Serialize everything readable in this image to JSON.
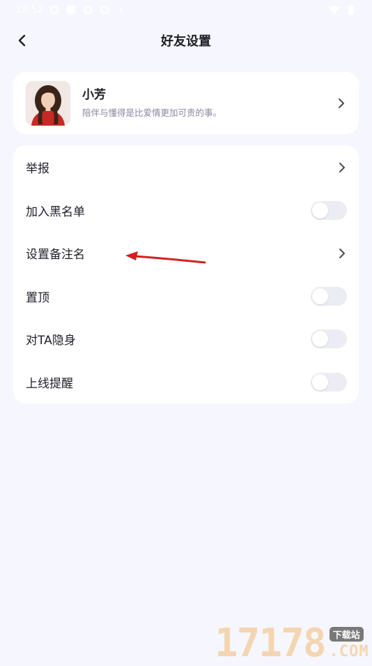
{
  "status_bar": {
    "time": "12:52"
  },
  "header": {
    "title": "好友设置",
    "back_icon": "chevron-left-icon"
  },
  "profile": {
    "name": "小芳",
    "signature": "陪伴与懂得是比爱情更加可贵的事。"
  },
  "settings": {
    "items": [
      {
        "label": "举报",
        "control": "chevron"
      },
      {
        "label": "加入黑名单",
        "control": "toggle",
        "on": false
      },
      {
        "label": "设置备注名",
        "control": "chevron"
      },
      {
        "label": "置顶",
        "control": "toggle",
        "on": false
      },
      {
        "label": "对TA隐身",
        "control": "toggle",
        "on": false
      },
      {
        "label": "上线提醒",
        "control": "toggle",
        "on": false
      }
    ]
  },
  "colors": {
    "background": "#f6f6fe",
    "card": "#ffffff",
    "toggle_off": "#ececf4",
    "annotation_arrow": "#d42020",
    "signature_text": "#8a88a0"
  },
  "watermark": {
    "digits": "17178",
    "badge": "下载站",
    "suffix": ".COM"
  }
}
